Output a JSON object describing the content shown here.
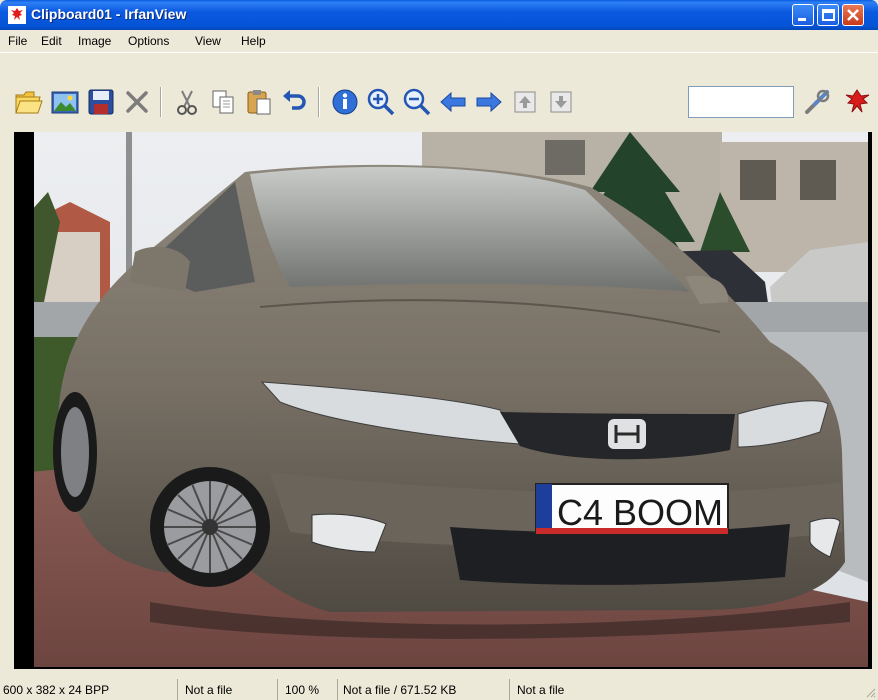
{
  "window": {
    "title": "Clipboard01 - IrfanView"
  },
  "menu": {
    "items": [
      "File",
      "Edit",
      "Image",
      "Options",
      "View",
      "Help"
    ]
  },
  "toolbar": {
    "search_value": ""
  },
  "image": {
    "plate_text": "C4 BOOM"
  },
  "status": {
    "dimensions": "600 x 382 x 24 BPP",
    "file1": "Not a file",
    "zoom": "100 %",
    "filesize": "Not a file / 671.52 KB",
    "file2": "Not a file"
  },
  "colors": {
    "titlebar": "#0b59e0",
    "chrome": "#ece9d8",
    "car_body": "#7a7266"
  },
  "icons": [
    "open-folder-icon",
    "thumbnails-icon",
    "save-icon",
    "delete-icon",
    "cut-icon",
    "copy-icon",
    "paste-icon",
    "undo-icon",
    "info-icon",
    "zoom-in-icon",
    "zoom-out-icon",
    "previous-icon",
    "next-icon",
    "first-page-icon",
    "last-page-icon",
    "settings-icon",
    "irfanview-icon"
  ]
}
